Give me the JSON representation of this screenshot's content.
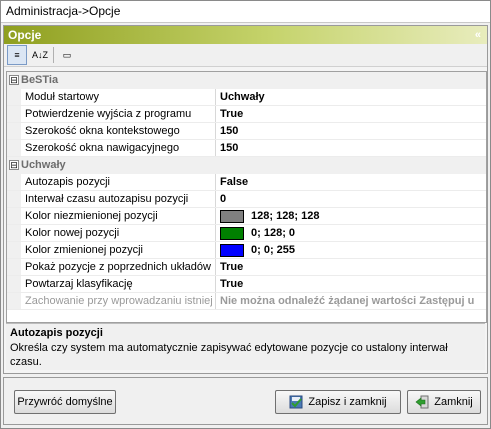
{
  "window": {
    "title": "Administracja->Opcje"
  },
  "panel": {
    "title": "Opcje",
    "collapse_icon": "«"
  },
  "toolbar": {
    "categorized_label": "≡",
    "alphabetical_label": "A↓Z",
    "pages_label": "▭"
  },
  "grid": {
    "categories": [
      {
        "name": "BeSTia",
        "toggle": "⊟",
        "rows": [
          {
            "name": "Moduł startowy",
            "value": "Uchwały"
          },
          {
            "name": "Potwierdzenie wyjścia z programu",
            "value": "True"
          },
          {
            "name": "Szerokość okna kontekstowego",
            "value": "150"
          },
          {
            "name": "Szerokość okna nawigacyjnego",
            "value": "150"
          }
        ]
      },
      {
        "name": "Uchwały",
        "toggle": "⊟",
        "rows": [
          {
            "name": "Autozapis pozycji",
            "value": "False"
          },
          {
            "name": "Interwał czasu autozapisu pozycji",
            "value": "0"
          },
          {
            "name": "Kolor niezmienionej pozycji",
            "value": "128; 128; 128",
            "color": "#808080"
          },
          {
            "name": "Kolor nowej pozycji",
            "value": "0; 128; 0",
            "color": "#008000"
          },
          {
            "name": "Kolor zmienionej pozycji",
            "value": "0; 0; 255",
            "color": "#0000ff"
          },
          {
            "name": "Pokaż pozycje z poprzednich układów",
            "value": "True"
          },
          {
            "name": "Powtarzaj klasyfikację",
            "value": "True"
          },
          {
            "name": "Zachowanie przy wprowadzaniu istniej",
            "value": "Nie można odnaleźć żądanej wartości Zastępuj u"
          }
        ]
      }
    ]
  },
  "description": {
    "title": "Autozapis pozycji",
    "text": "Określa czy system ma automatycznie zapisywać edytowane pozycje co ustalony interwał czasu."
  },
  "footer": {
    "reset_label": "Przywróć domyślne",
    "save_label": "Zapisz i zamknij",
    "close_label": "Zamknij"
  },
  "colors": {
    "header_accent": "#8f9f1f",
    "unchanged": "#808080",
    "new": "#008000",
    "changed": "#0000ff"
  }
}
